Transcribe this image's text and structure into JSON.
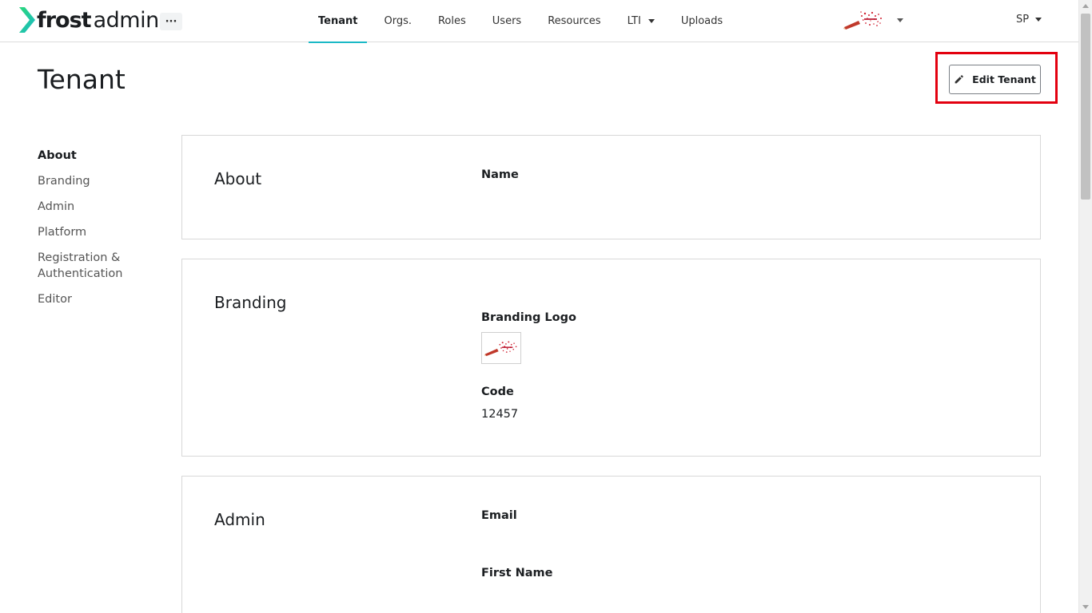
{
  "app": {
    "logo_word_bold": "frost",
    "logo_word_light": "admin",
    "more_label": "···",
    "brand_color": "#1bb9c6"
  },
  "nav": {
    "items": [
      {
        "label": "Tenant",
        "active": true
      },
      {
        "label": "Orgs.",
        "active": false
      },
      {
        "label": "Roles",
        "active": false
      },
      {
        "label": "Users",
        "active": false
      },
      {
        "label": "Resources",
        "active": false
      },
      {
        "label": "LTI",
        "active": false,
        "dropdown": true
      },
      {
        "label": "Uploads",
        "active": false
      }
    ]
  },
  "user_menu": {
    "initials": "SP"
  },
  "page": {
    "title": "Tenant",
    "edit_button_label": "Edit Tenant",
    "edit_icon": "pencil-icon",
    "highlight_color": "#e3000f"
  },
  "sidenav": {
    "items": [
      {
        "label": "About",
        "active": true
      },
      {
        "label": "Branding",
        "active": false
      },
      {
        "label": "Admin",
        "active": false
      },
      {
        "label": "Platform",
        "active": false
      },
      {
        "label": "Registration & Authentication",
        "active": false
      },
      {
        "label": "Editor",
        "active": false
      }
    ]
  },
  "sections": {
    "about": {
      "title": "About",
      "name_label": "Name",
      "name_value": ""
    },
    "branding": {
      "title": "Branding",
      "logo_label": "Branding Logo",
      "code_label": "Code",
      "code_value": "12457"
    },
    "admin": {
      "title": "Admin",
      "email_label": "Email",
      "first_name_label": "First Name"
    }
  }
}
